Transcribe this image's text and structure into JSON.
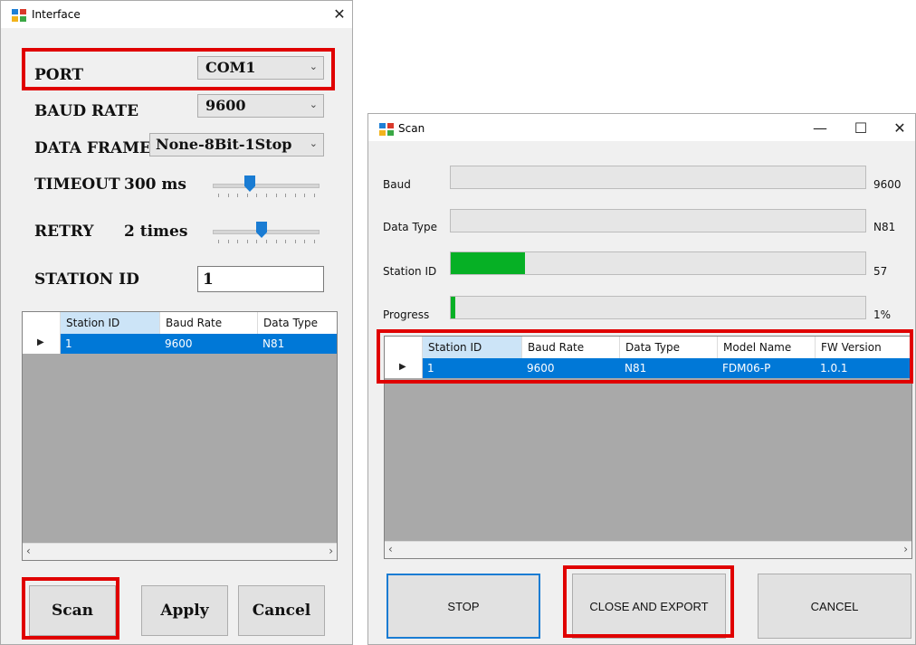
{
  "interface_window": {
    "title": "Interface",
    "close": "✕",
    "port": {
      "label": "PORT",
      "value": "COM1"
    },
    "baud": {
      "label": "BAUD RATE",
      "value": "9600"
    },
    "frame": {
      "label": "DATA FRAME",
      "value": "None-8Bit-1Stop"
    },
    "timeout": {
      "label": "TIMEOUT",
      "value": "300 ms",
      "level": 0.33
    },
    "retry": {
      "label": "RETRY",
      "value": "2 times",
      "level": 0.45
    },
    "station": {
      "label": "STATION ID",
      "value": "1"
    },
    "grid": {
      "columns": [
        "Station ID",
        "Baud Rate",
        "Data Type"
      ],
      "rows": [
        [
          "1",
          "9600",
          "N81"
        ]
      ]
    },
    "buttons": {
      "scan": "Scan",
      "apply": "Apply",
      "cancel": "Cancel"
    }
  },
  "scan_window": {
    "title": "Scan",
    "controls": {
      "minimize": "—",
      "maximize": "☐",
      "close": "✕"
    },
    "baud": {
      "label": "Baud",
      "value": "9600",
      "level": 0
    },
    "data_type": {
      "label": "Data Type",
      "value": "N81",
      "level": 0
    },
    "station_id": {
      "label": "Station ID",
      "value": "57",
      "level": 0.18
    },
    "progress": {
      "label": "Progress",
      "value": "1%",
      "level": 0.01
    },
    "grid": {
      "columns": [
        "Station ID",
        "Baud Rate",
        "Data Type",
        "Model Name",
        "FW Version"
      ],
      "rows": [
        [
          "1",
          "9600",
          "N81",
          "FDM06-P",
          "1.0.1"
        ]
      ]
    },
    "buttons": {
      "stop": "STOP",
      "close_export": "CLOSE AND EXPORT",
      "cancel": "CANCEL"
    }
  },
  "colors": {
    "highlight": "#e00000",
    "selection": "#0078d7",
    "progress_fill": "#06b025",
    "slider_thumb": "#1a7cd3"
  },
  "icons": [
    "app-icon",
    "close-icon",
    "minimize-icon",
    "maximize-icon",
    "row-pointer-icon",
    "scroll-left-icon",
    "scroll-right-icon",
    "dropdown-arrow-icon"
  ]
}
